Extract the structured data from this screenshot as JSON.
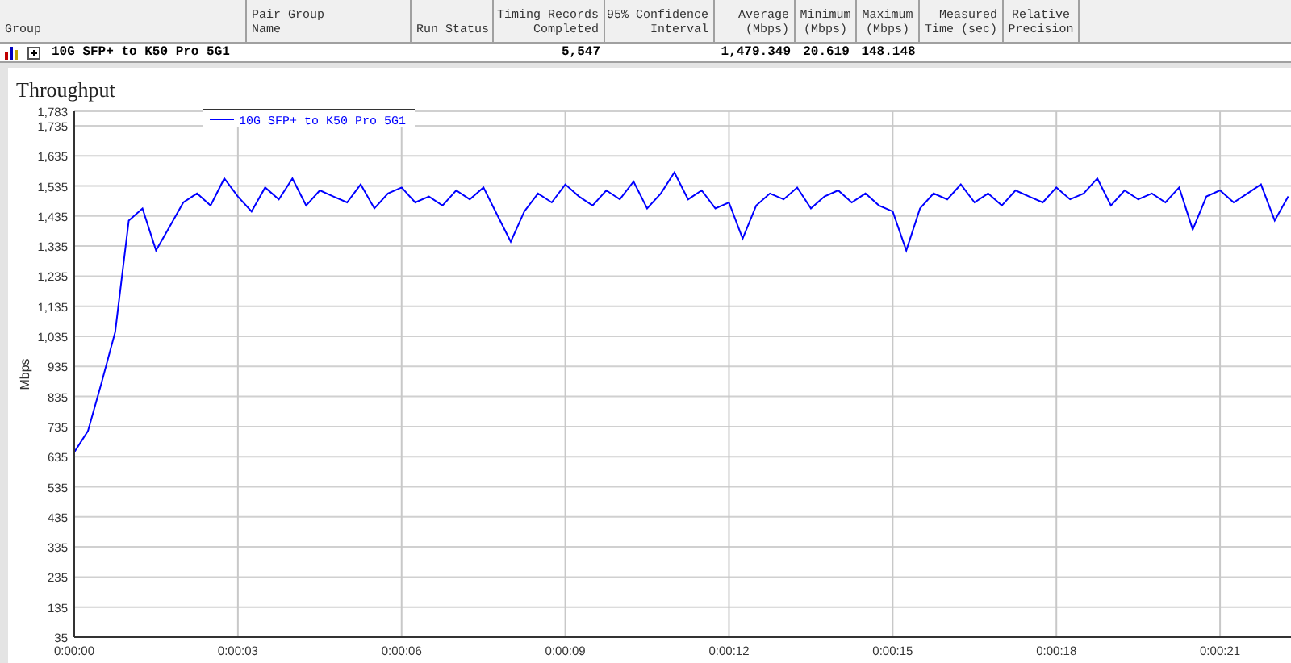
{
  "table": {
    "columns": [
      {
        "label": "Group"
      },
      {
        "label": "Pair Group\nName"
      },
      {
        "label": "Run Status"
      },
      {
        "label": "Timing Records\nCompleted"
      },
      {
        "label": "95% Confidence\nInterval"
      },
      {
        "label": "Average\n(Mbps)"
      },
      {
        "label": "Minimum\n(Mbps)"
      },
      {
        "label": "Maximum\n(Mbps)"
      },
      {
        "label": "Measured\nTime (sec)"
      },
      {
        "label": "Relative\nPrecision"
      }
    ],
    "rows": [
      {
        "expanded": false,
        "cells": [
          "10G SFP+ to K50 Pro 5G1",
          "",
          "",
          "5,547",
          "",
          "1,479.349",
          "20.619",
          "148.148",
          "",
          ""
        ]
      }
    ]
  },
  "chart": {
    "chart_data": {
      "type": "line",
      "title": "Throughput",
      "ylabel": "Mbps",
      "x": [
        0,
        0.25,
        0.5,
        0.75,
        1,
        1.25,
        1.5,
        1.75,
        2,
        2.25,
        2.5,
        2.75,
        3,
        3.25,
        3.5,
        3.75,
        4,
        4.25,
        4.5,
        4.75,
        5,
        5.25,
        5.5,
        5.75,
        6,
        6.25,
        6.5,
        6.75,
        7,
        7.25,
        7.5,
        7.75,
        8,
        8.25,
        8.5,
        8.75,
        9,
        9.25,
        9.5,
        9.75,
        10,
        10.25,
        10.5,
        10.75,
        11,
        11.25,
        11.5,
        11.75,
        12,
        12.25,
        12.5,
        12.75,
        13,
        13.25,
        13.5,
        13.75,
        14,
        14.25,
        14.5,
        14.75,
        15,
        15.25,
        15.5,
        15.75,
        16,
        16.25,
        16.5,
        16.75,
        17,
        17.25,
        17.5,
        17.75,
        18,
        18.25,
        18.5,
        18.75,
        19,
        19.25,
        19.5,
        19.75,
        20,
        20.25,
        20.5,
        20.75,
        21,
        21.25,
        21.5,
        21.75,
        22,
        22.25
      ],
      "series": [
        {
          "name": "10G SFP+ to K50 Pro 5G1",
          "color": "#0000ff",
          "values": [
            650,
            720,
            880,
            1050,
            1420,
            1460,
            1320,
            1400,
            1480,
            1510,
            1470,
            1560,
            1500,
            1450,
            1530,
            1490,
            1560,
            1470,
            1520,
            1500,
            1480,
            1540,
            1460,
            1510,
            1530,
            1480,
            1500,
            1470,
            1520,
            1490,
            1530,
            1440,
            1350,
            1450,
            1510,
            1480,
            1540,
            1500,
            1470,
            1520,
            1490,
            1550,
            1460,
            1510,
            1580,
            1490,
            1520,
            1460,
            1480,
            1360,
            1470,
            1510,
            1490,
            1530,
            1460,
            1500,
            1520,
            1480,
            1510,
            1470,
            1450,
            1320,
            1460,
            1510,
            1490,
            1540,
            1480,
            1510,
            1470,
            1520,
            1500,
            1480,
            1530,
            1490,
            1510,
            1560,
            1470,
            1520,
            1490,
            1510,
            1480,
            1530,
            1390,
            1500,
            1520,
            1480,
            1510,
            1540,
            1420,
            1500
          ]
        }
      ],
      "xlim": [
        0,
        22.3
      ],
      "ylim": [
        35,
        1783
      ],
      "grid": true,
      "xticks": [
        {
          "value": 0,
          "label": "0:00:00"
        },
        {
          "value": 3,
          "label": "0:00:03"
        },
        {
          "value": 6,
          "label": "0:00:06"
        },
        {
          "value": 9,
          "label": "0:00:09"
        },
        {
          "value": 12,
          "label": "0:00:12"
        },
        {
          "value": 15,
          "label": "0:00:15"
        },
        {
          "value": 18,
          "label": "0:00:18"
        },
        {
          "value": 21,
          "label": "0:00:21"
        }
      ],
      "yticks": [
        {
          "value": 35,
          "label": "35"
        },
        {
          "value": 135,
          "label": "135"
        },
        {
          "value": 235,
          "label": "235"
        },
        {
          "value": 335,
          "label": "335"
        },
        {
          "value": 435,
          "label": "435"
        },
        {
          "value": 535,
          "label": "535"
        },
        {
          "value": 635,
          "label": "635"
        },
        {
          "value": 735,
          "label": "735"
        },
        {
          "value": 835,
          "label": "835"
        },
        {
          "value": 935,
          "label": "935"
        },
        {
          "value": 1035,
          "label": "1,035"
        },
        {
          "value": 1135,
          "label": "1,135"
        },
        {
          "value": 1235,
          "label": "1,235"
        },
        {
          "value": 1335,
          "label": "1,335"
        },
        {
          "value": 1435,
          "label": "1,435"
        },
        {
          "value": 1535,
          "label": "1,535"
        },
        {
          "value": 1635,
          "label": "1,635"
        },
        {
          "value": 1735,
          "label": "1,735"
        },
        {
          "value": 1783,
          "label": "1,783"
        }
      ]
    }
  }
}
